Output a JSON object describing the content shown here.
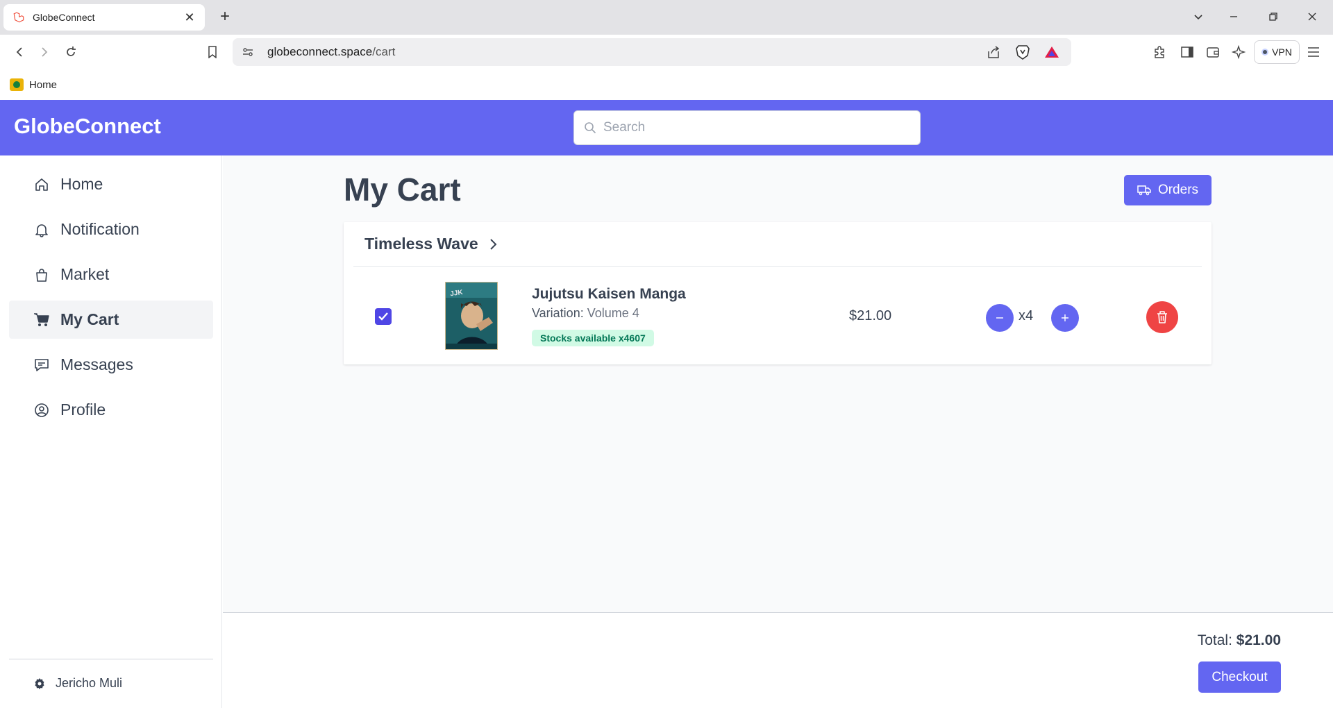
{
  "browser": {
    "tab_title": "GlobeConnect",
    "url_host": "globeconnect.space",
    "url_path": "/cart",
    "vpn_label": "VPN",
    "bookmark_home": "Home"
  },
  "app": {
    "brand": "GlobeConnect",
    "search_placeholder": "Search",
    "accent_color": "#6366f1"
  },
  "sidebar": {
    "items": [
      {
        "label": "Home",
        "icon": "home-icon"
      },
      {
        "label": "Notification",
        "icon": "bell-icon"
      },
      {
        "label": "Market",
        "icon": "shopping-bag-icon"
      },
      {
        "label": "My Cart",
        "icon": "cart-icon",
        "active": true
      },
      {
        "label": "Messages",
        "icon": "chat-icon"
      },
      {
        "label": "Profile",
        "icon": "user-circle-icon"
      }
    ],
    "user_name": "Jericho Muli"
  },
  "main": {
    "title": "My Cart",
    "orders_label": "Orders",
    "shop_name": "Timeless Wave",
    "item": {
      "name": "Jujutsu Kaisen Manga",
      "variation_label": "Variation:",
      "variation_value": "Volume 4",
      "stock": "Stocks available x4607",
      "price": "$21.00",
      "quantity": "x4",
      "checked": true
    }
  },
  "footer": {
    "total_label": "Total:",
    "total_value": "$21.00",
    "checkout_label": "Checkout"
  }
}
